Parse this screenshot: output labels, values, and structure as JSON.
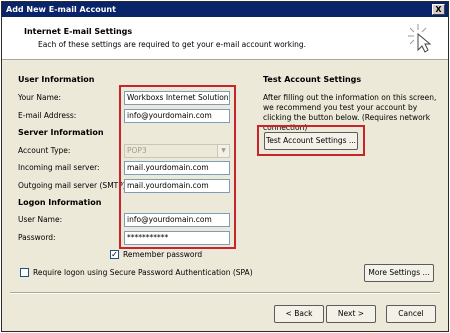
{
  "window": {
    "title": "Add New E-mail Account",
    "close_glyph": "X"
  },
  "header": {
    "title": "Internet E-mail Settings",
    "subtitle": "Each of these settings are required to get your e-mail account working."
  },
  "user_information": {
    "heading": "User Information",
    "name_label": "Your Name:",
    "name_value": "Workboxs Internet Solution",
    "email_label": "E-mail Address:",
    "email_value": "info@yourdomain.com"
  },
  "server_information": {
    "heading": "Server Information",
    "account_type_label": "Account Type:",
    "account_type_value": "POP3",
    "incoming_label": "Incoming mail server:",
    "incoming_value": "mail.yourdomain.com",
    "outgoing_label": "Outgoing mail server (SMTP):",
    "outgoing_value": "mail.yourdomain.com"
  },
  "logon_information": {
    "heading": "Logon Information",
    "username_label": "User Name:",
    "username_value": "info@yourdomain.com",
    "password_label": "Password:",
    "password_value": "***********",
    "remember_label": "Remember password",
    "remember_checked": true,
    "remember_glyph": "✓",
    "spa_label": "Require logon using Secure Password Authentication (SPA)",
    "spa_checked": false
  },
  "test_settings": {
    "heading": "Test Account Settings",
    "description": "After filling out the information on this screen, we recommend you test your account by clicking the button below. (Requires network connection)",
    "button_label": "Test Account Settings ..."
  },
  "buttons": {
    "more_settings": "More Settings ...",
    "back": "< Back",
    "next": "Next >",
    "cancel": "Cancel"
  },
  "colors": {
    "titlebar": "#0a246a",
    "highlight": "#c8242c",
    "dialog_bg": "#ece9d8"
  }
}
